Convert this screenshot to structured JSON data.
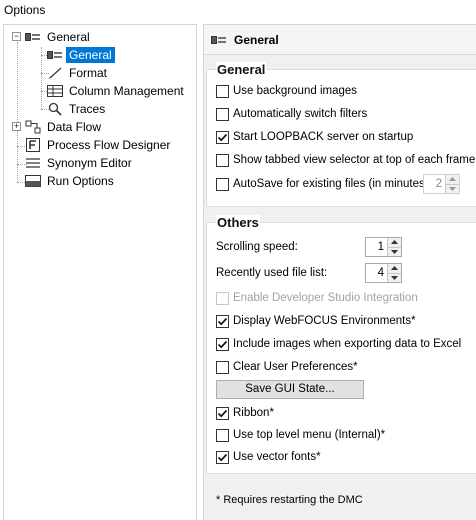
{
  "window": {
    "title": "Options"
  },
  "tree": {
    "root_general": "General",
    "child_general": "General",
    "format": "Format",
    "column_management": "Column Management",
    "traces": "Traces",
    "data_flow": "Data Flow",
    "process_flow_designer": "Process Flow Designer",
    "synonym_editor": "Synonym Editor",
    "run_options": "Run Options",
    "expander_collapse": "−",
    "expander_expand": "+"
  },
  "header": {
    "title": "General"
  },
  "general_group": {
    "title": "General",
    "use_background_images": {
      "label": "Use background images",
      "checked": false
    },
    "auto_switch_filters": {
      "label": "Automatically switch filters",
      "checked": false
    },
    "start_loopback": {
      "label": "Start LOOPBACK server on startup",
      "checked": true
    },
    "tabbed_view_selector": {
      "label": "Show tabbed view selector at top of each frame",
      "checked": false
    },
    "autosave": {
      "label": "AutoSave for existing files (in minutes):",
      "checked": false,
      "value": "2"
    }
  },
  "others_group": {
    "title": "Others",
    "scrolling_speed": {
      "label": "Scrolling speed:",
      "value": "1"
    },
    "recent_files": {
      "label": "Recently used file list:",
      "value": "4"
    },
    "developer_studio": {
      "label": "Enable Developer Studio Integration",
      "checked": false,
      "disabled": true
    },
    "display_webfocus": {
      "label": "Display WebFOCUS Environments*",
      "checked": true
    },
    "include_images": {
      "label": "Include images when exporting data to Excel",
      "checked": true
    },
    "clear_prefs": {
      "label": "Clear User Preferences*",
      "checked": false
    },
    "save_gui_button": "Save GUI State...",
    "ribbon": {
      "label": "Ribbon*",
      "checked": true
    },
    "top_level_menu": {
      "label": "Use top level menu (Internal)*",
      "checked": false
    },
    "vector_fonts": {
      "label": "Use vector fonts*",
      "checked": true
    }
  },
  "footnote": "* Requires restarting the DMC",
  "colors": {
    "selection": "#0078d7",
    "panel_bg": "#f0f0f0"
  }
}
